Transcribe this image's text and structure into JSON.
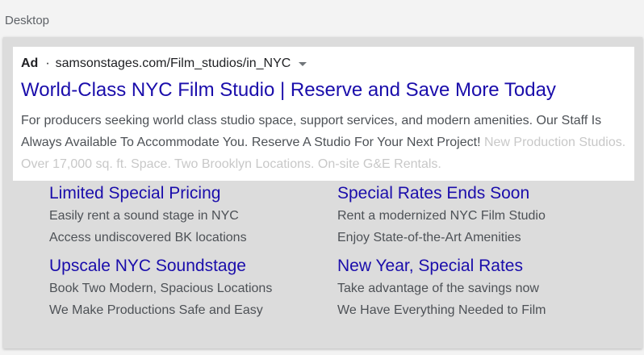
{
  "device_label": "Desktop",
  "ad": {
    "badge": "Ad",
    "separator": "·",
    "display_url": "samsonstages.com/Film_studios/in_NYC",
    "headline": "World-Class NYC Film Studio | Reserve and Save More Today",
    "description_main": "For producers seeking world class studio space, support services, and modern amenities. Our Staff Is Always Available To Accommodate You. Reserve A Studio For Your Next Project! ",
    "description_faded": "New Production Studios. Over 17,000 sq. ft. Space. Two Brooklyn Locations. On-site G&E Rentals."
  },
  "sitelinks": [
    {
      "title": "Limited Special Pricing",
      "line1": "Easily rent a sound stage in NYC",
      "line2": "Access undiscovered BK locations"
    },
    {
      "title": "Special Rates Ends Soon",
      "line1": "Rent a modernized NYC Film Studio",
      "line2": "Enjoy State-of-the-Art Amenities"
    },
    {
      "title": "Upscale NYC Soundstage",
      "line1": "Book Two Modern, Spacious Locations",
      "line2": "We Make Productions Safe and Easy"
    },
    {
      "title": "New Year, Special Rates",
      "line1": "Take advantage of the savings now",
      "line2": "We Have Everything Needed to Film"
    }
  ],
  "colors": {
    "link": "#1a0dab",
    "text": "#4d5156",
    "faded_text": "#c8c8c8",
    "frame_background": "#dcdcdc"
  },
  "icons": {
    "url_menu": "caret-down-icon"
  }
}
